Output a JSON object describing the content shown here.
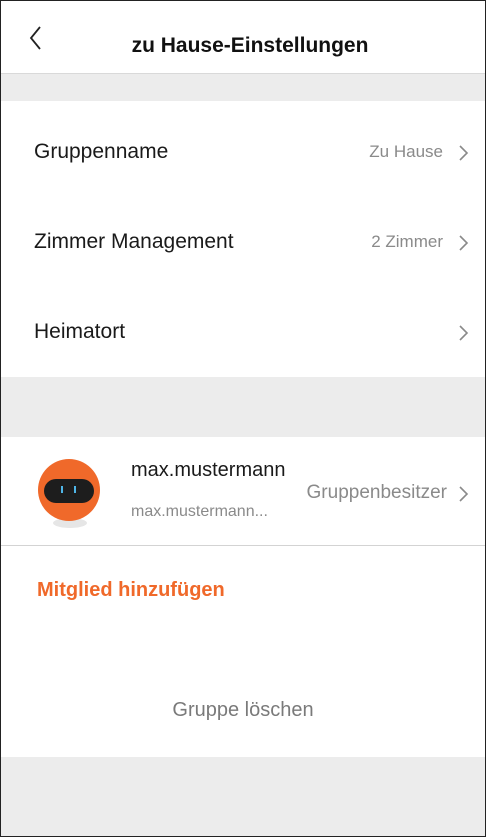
{
  "header": {
    "title": "zu Hause-Einstellungen",
    "back_icon": "chevron-left-icon"
  },
  "settings": {
    "rows": [
      {
        "label": "Gruppenname",
        "value": "Zu Hause"
      },
      {
        "label": "Zimmer Management",
        "value": "2 Zimmer"
      },
      {
        "label": "Heimatort",
        "value": ""
      }
    ]
  },
  "member": {
    "name": "max.mustermann",
    "email": "max.mustermann...",
    "role": "Gruppenbesitzer",
    "avatar_icon": "robot-avatar-icon"
  },
  "actions": {
    "add_member": "Mitglied hinzufügen",
    "delete_group": "Gruppe löschen"
  },
  "colors": {
    "accent": "#f0692a",
    "section_gap": "#ececec",
    "secondary_text": "#8a8a8a"
  }
}
